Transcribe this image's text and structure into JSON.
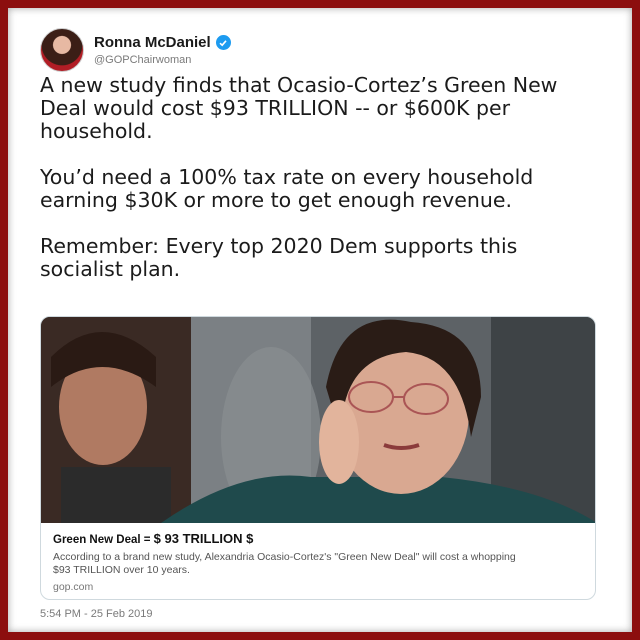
{
  "tweet": {
    "display_name": "Ronna McDaniel",
    "handle": "@GOPChairwoman",
    "paragraphs": [
      "A new study finds that Ocasio-Cortez’s Green New Deal would cost $93 TRILLION -- or $600K per household.",
      "You’d need a 100% tax rate on every household earning $30K or more to get enough revenue.",
      "Remember: Every top 2020 Dem supports this socialist plan."
    ],
    "timestamp": "5:54 PM - 25 Feb 2019"
  },
  "card": {
    "title_prefix": "Green New Deal = ",
    "title_amount": "$ 93 TRILLION $",
    "description": "According to a brand new study, Alexandria Ocasio-Cortez's \"Green New Deal\" will cost a whopping $93 TRILLION over 10 years.",
    "domain": "gop.com"
  },
  "colors": {
    "frame_border": "#8c0e0e",
    "verified_badge": "#1d9bf0"
  }
}
